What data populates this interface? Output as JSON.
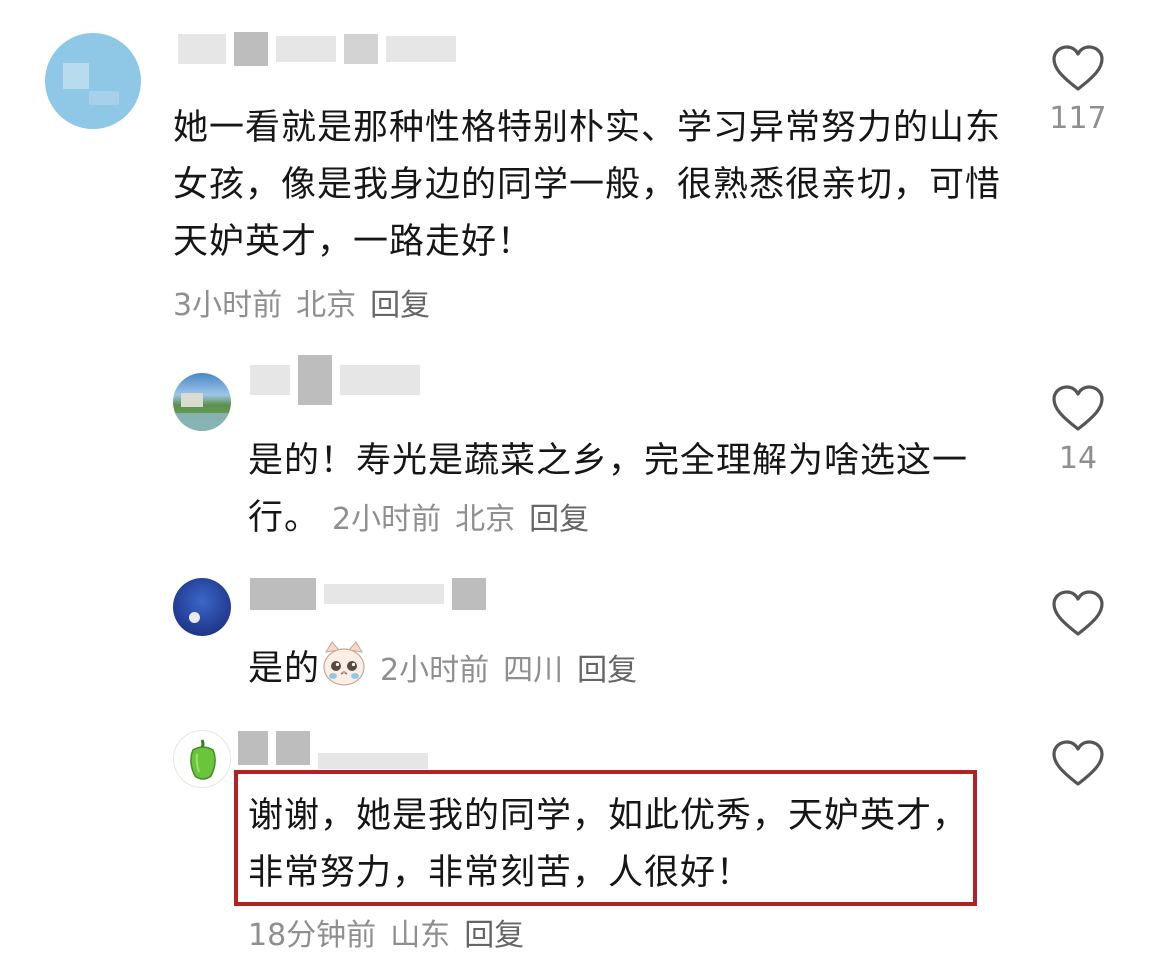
{
  "comments": [
    {
      "text": "她一看就是那种性格特别朴实、学习异常努力的山东女孩，像是我身边的同学一般，很熟悉很亲切，可惜天妒英才，一路走好！",
      "time": "3小时前",
      "location": "北京",
      "reply": "回复",
      "likes": "117"
    },
    {
      "text": "是的！寿光是蔬菜之乡，完全理解为啥选这一行。",
      "time": "2小时前",
      "location": "北京",
      "reply": "回复",
      "likes": "14"
    },
    {
      "text": "是的",
      "time": "2小时前",
      "location": "四川",
      "reply": "回复",
      "likes": ""
    },
    {
      "text": "谢谢，她是我的同学，如此优秀，天妒英才，非常努力，非常刻苦，人很好！",
      "time": "18分钟前",
      "location": "山东",
      "reply": "回复",
      "likes": ""
    }
  ],
  "icons": {
    "like": "heart-outline-icon",
    "emoji": "crying-cat-emoji",
    "avatar4": "green-pepper-icon"
  },
  "colors": {
    "highlight_border": "#b22222",
    "meta_text": "#8f8f8f",
    "body_text": "#161616"
  }
}
